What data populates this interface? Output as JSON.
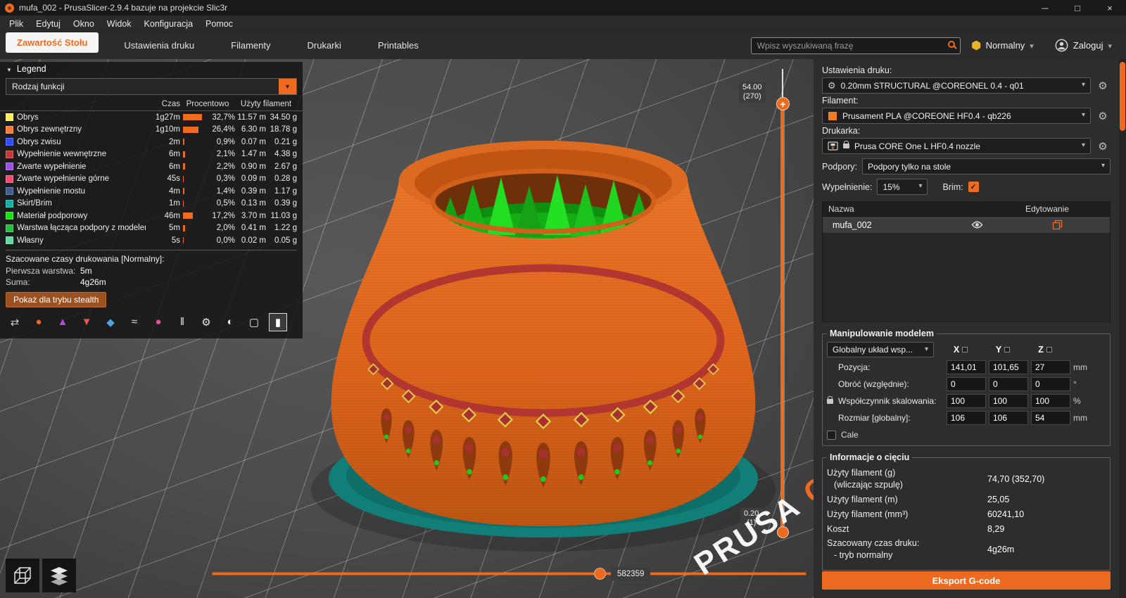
{
  "window": {
    "title": "mufa_002 - PrusaSlicer-2.9.4 bazuje na projekcie Slic3r",
    "controls": {
      "minimize": "─",
      "maximize": "□",
      "close": "×"
    }
  },
  "menubar": {
    "items": [
      "Plik",
      "Edytuj",
      "Okno",
      "Widok",
      "Konfiguracja",
      "Pomoc"
    ]
  },
  "tabbar": {
    "tabs": [
      {
        "label": "Zawartość Stołu",
        "active": true
      },
      {
        "label": "Ustawienia druku"
      },
      {
        "label": "Filamenty"
      },
      {
        "label": "Drukarki"
      },
      {
        "label": "Printables"
      }
    ],
    "search": {
      "placeholder": "Wpisz wyszukiwaną frazę"
    },
    "mode": {
      "label": "Normalny",
      "color": "#E9B32A"
    },
    "login": {
      "label": "Zaloguj"
    }
  },
  "legend": {
    "title": "Legend",
    "view_mode": "Rodzaj funkcji",
    "columns": {
      "czas": "Czas",
      "procentowo": "Procentowo",
      "filament": "Użyty filament"
    },
    "rows": [
      {
        "name": "Obrys",
        "color": "#FFEE58",
        "czas": "1g27m",
        "pct": "32,7%",
        "bar": "27px",
        "m": "11.57 m",
        "g": "34.50 g"
      },
      {
        "name": "Obrys zewnętrzny",
        "color": "#FF7D38",
        "czas": "1g10m",
        "pct": "26,4%",
        "bar": "22px",
        "m": "6.30 m",
        "g": "18.78 g"
      },
      {
        "name": "Obrys zwisu",
        "color": "#2F4BFF",
        "czas": "2m",
        "pct": "0,9%",
        "bar": "2px",
        "m": "0.07 m",
        "g": "0.21 g"
      },
      {
        "name": "Wypełnienie wewnętrzne",
        "color": "#C03838",
        "czas": "6m",
        "pct": "2,1%",
        "bar": "3px",
        "m": "1.47 m",
        "g": "4.38 g"
      },
      {
        "name": "Zwarte wypełnienie",
        "color": "#9B50E6",
        "czas": "6m",
        "pct": "2,2%",
        "bar": "3px",
        "m": "0.90 m",
        "g": "2.67 g"
      },
      {
        "name": "Zwarte wypełnienie górne",
        "color": "#EE4C74",
        "czas": "45s",
        "pct": "0,3%",
        "bar": "1px",
        "m": "0.09 m",
        "g": "0.28 g"
      },
      {
        "name": "Wypełnienie mostu",
        "color": "#3E5C8C",
        "czas": "4m",
        "pct": "1,4%",
        "bar": "2px",
        "m": "0.39 m",
        "g": "1.17 g"
      },
      {
        "name": "Skirt/Brim",
        "color": "#15B2A4",
        "czas": "1m",
        "pct": "0,5%",
        "bar": "1px",
        "m": "0.13 m",
        "g": "0.39 g"
      },
      {
        "name": "Materiał podporowy",
        "color": "#13E613",
        "czas": "46m",
        "pct": "17,2%",
        "bar": "14px",
        "m": "3.70 m",
        "g": "11.03 g"
      },
      {
        "name": "Warstwa łącząca podpory z modelem",
        "color": "#27BE3E",
        "czas": "5m",
        "pct": "2,0%",
        "bar": "3px",
        "m": "0.41 m",
        "g": "1.22 g"
      },
      {
        "name": "Własny",
        "color": "#64D6A4",
        "czas": "5s",
        "pct": "0,0%",
        "bar": "1px",
        "m": "0.02 m",
        "g": "0.05 g"
      }
    ],
    "times_header": "Szacowane czasy drukowania [Normalny]:",
    "first_layer_label": "Pierwsza warstwa:",
    "first_layer_value": "5m",
    "total_label": "Suma:",
    "total_value": "4g26m",
    "stealth_button": "Pokaż dla trybu stealth",
    "toolbar_icons": [
      {
        "name": "travels-icon",
        "glyph": "⇄",
        "color": "#cfcfcf"
      },
      {
        "name": "wipe-icon",
        "glyph": "●",
        "color": "#ED6B21"
      },
      {
        "name": "seams-icon",
        "glyph": "▲",
        "color": "#B14BE0"
      },
      {
        "name": "retractions-icon",
        "glyph": "▼",
        "color": "#E05A4B"
      },
      {
        "name": "deretractions-icon",
        "glyph": "◆",
        "color": "#4BA3E0"
      },
      {
        "name": "tool-changes-icon",
        "glyph": "≈",
        "color": "#e8e8e8"
      },
      {
        "name": "color-changes-icon",
        "glyph": "●",
        "color": "#E0529B"
      },
      {
        "name": "pause-prints-icon",
        "glyph": "‖",
        "color": "#e8e8e8"
      },
      {
        "name": "custom-gcode-icon",
        "glyph": "⚙",
        "color": "#e8e8e8"
      },
      {
        "name": "shells-icon",
        "glyph": "◐",
        "color": "#e8e8e8"
      },
      {
        "name": "box-icon",
        "glyph": "▢",
        "color": "#e8e8e8"
      },
      {
        "name": "legend-toggle-icon",
        "glyph": "▮",
        "color": "#ffffff",
        "active": true
      }
    ]
  },
  "viewport": {
    "vertical_slider": {
      "top_value": "54.00",
      "top_layer": "(270)",
      "bottom_value": "0.20",
      "bottom_layer": "(1)"
    },
    "horizontal_slider": {
      "label": "582359"
    },
    "watermark": "PRUSA",
    "watermark2": "C"
  },
  "right_panel": {
    "print_settings_label": "Ustawienia druku:",
    "print_settings_value": "0.20mm STRUCTURAL @COREONEL 0.4 - q01",
    "filament_label": "Filament:",
    "filament_value": "Prusament PLA @COREONE HF0.4 - qb226",
    "filament_color": "#F07B20",
    "printer_label": "Drukarka:",
    "printer_value": "Prusa CORE One L HF0.4 nozzle",
    "supports_label": "Podpory:",
    "supports_value": "Podpory tylko na stole",
    "infill_label": "Wypełnienie:",
    "infill_value": "15%",
    "brim_label": "Brim:",
    "list": {
      "col_name": "Nazwa",
      "col_edit": "Edytowanie",
      "object_name": "mufa_002"
    },
    "manipulation": {
      "title": "Manipulowanie modelem",
      "coord_system": "Globalny układ wsp...",
      "axes": [
        "X",
        "Y",
        "Z"
      ],
      "rows": [
        {
          "label": "Pozycja:",
          "x": "141,01",
          "y": "101,65",
          "z": "27",
          "unit": "mm"
        },
        {
          "label": "Obróć (względnie):",
          "x": "0",
          "y": "0",
          "z": "0",
          "unit": "°"
        },
        {
          "label": "Współczynnik skalowania:",
          "x": "100",
          "y": "100",
          "z": "100",
          "unit": "%",
          "lock": true
        },
        {
          "label": "Rozmiar [globalny]:",
          "x": "106",
          "y": "106",
          "z": "54",
          "unit": "mm"
        }
      ],
      "inches_label": "Cale"
    },
    "slicing_info": {
      "title": "Informacje o cięciu",
      "rows": [
        {
          "label": "Użyty filament (g)",
          "sub": "(wliczając szpulę)",
          "value": "74,70 (352,70)"
        },
        {
          "label": "Użyty filament (m)",
          "sub": "",
          "value": "25,05"
        },
        {
          "label": "Użyty filament (mm³)",
          "sub": "",
          "value": "60241,10"
        },
        {
          "label": "Koszt",
          "sub": "",
          "value": "8,29"
        },
        {
          "label": "Szacowany czas druku:",
          "sub": "- tryb normalny",
          "value": "4g26m"
        }
      ]
    },
    "export_button": "Eksport G-code"
  }
}
